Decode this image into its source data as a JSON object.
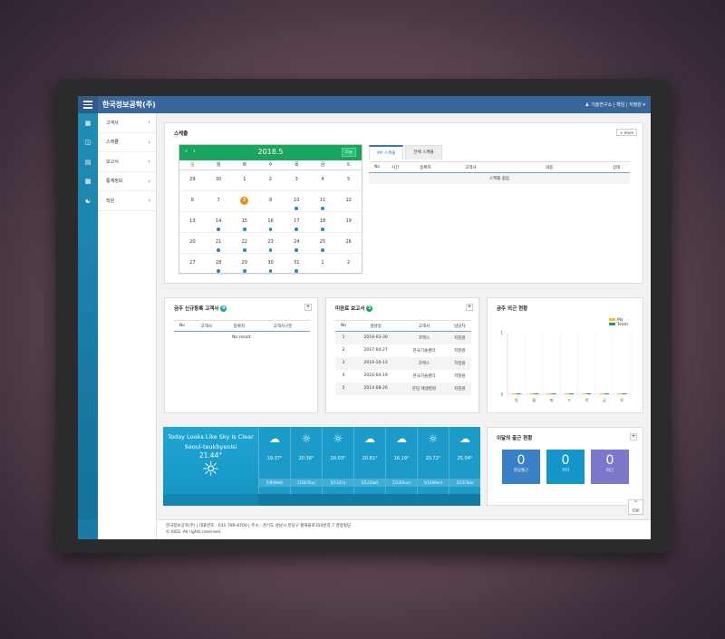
{
  "topbar": {
    "brand": "한국정보공학(주)",
    "user": "기술연구소 | 책임 | 지정원 ▾"
  },
  "sidebar": {
    "items": [
      {
        "label": "고객사",
        "icon": "briefcase-icon"
      },
      {
        "label": "스케쥴",
        "icon": "calendar-icon"
      },
      {
        "label": "보고서",
        "icon": "document-icon"
      },
      {
        "label": "통계정보",
        "icon": "bar-chart-icon"
      },
      {
        "label": "직원",
        "icon": "users-icon"
      }
    ]
  },
  "schedule": {
    "title": "스케쥴",
    "more": "+ more",
    "month": "2018.5",
    "today_btn": "오늘",
    "dow": [
      "일",
      "월",
      "화",
      "수",
      "목",
      "금",
      "토"
    ],
    "weeks": [
      [
        {
          "d": "29",
          "o": 1
        },
        {
          "d": "30",
          "o": 1
        },
        {
          "d": "1"
        },
        {
          "d": "2"
        },
        {
          "d": "3"
        },
        {
          "d": "4"
        },
        {
          "d": "5"
        }
      ],
      [
        {
          "d": "6"
        },
        {
          "d": "7"
        },
        {
          "d": "8",
          "t": 1
        },
        {
          "d": "9"
        },
        {
          "d": "10",
          "e": 1
        },
        {
          "d": "11",
          "e": 1
        },
        {
          "d": "12"
        }
      ],
      [
        {
          "d": "13"
        },
        {
          "d": "14",
          "e": 1
        },
        {
          "d": "15",
          "e": 1
        },
        {
          "d": "16",
          "e": 1
        },
        {
          "d": "17",
          "e": 1
        },
        {
          "d": "18",
          "e": 1
        },
        {
          "d": "19"
        }
      ],
      [
        {
          "d": "20"
        },
        {
          "d": "21",
          "e": 1
        },
        {
          "d": "22",
          "e": 1
        },
        {
          "d": "23",
          "e": 1
        },
        {
          "d": "24",
          "e": 1
        },
        {
          "d": "25",
          "e": 1
        },
        {
          "d": "26"
        }
      ],
      [
        {
          "d": "27"
        },
        {
          "d": "28",
          "e": 1
        },
        {
          "d": "29",
          "e": 1
        },
        {
          "d": "30",
          "e": 1
        },
        {
          "d": "31",
          "e": 1
        },
        {
          "d": "1",
          "o": 1
        },
        {
          "d": "2",
          "o": 1
        }
      ]
    ],
    "tabs": [
      "MY 스케쥴",
      "전체 스케쥴"
    ],
    "cols": [
      "No",
      "시간",
      "등록자",
      "고객사",
      "내용",
      "상태"
    ],
    "empty": "스케쥴 없음"
  },
  "customers": {
    "title": "금주 신규등록 고객사",
    "count": "0",
    "cols": [
      "No",
      "고객사",
      "등록자",
      "고객사구분"
    ],
    "empty": "No result."
  },
  "reports": {
    "title": "미완료 보고서",
    "count": "5",
    "cols": [
      "No",
      "생성일",
      "고객사",
      "담당자"
    ],
    "rows": [
      [
        "1",
        "2018-03-30",
        "코엑스",
        "지정원"
      ],
      [
        "2",
        "2017-04-27",
        "한국기술센터",
        "지정원"
      ],
      [
        "3",
        "2016-10-13",
        "코엑스",
        "지정원"
      ],
      [
        "4",
        "2016-04-19",
        "한국기술센터",
        "지정원"
      ],
      [
        "5",
        "2014-08-26",
        "분당 제생병원",
        "지정원"
      ]
    ]
  },
  "outside": {
    "title": "금주 외근 현황",
    "chart_data": {
      "type": "bar",
      "categories": [
        "일",
        "월",
        "화",
        "수",
        "목",
        "금",
        "토"
      ],
      "series": [
        {
          "name": "My",
          "values": [
            0,
            0,
            0,
            0,
            0,
            0,
            0
          ],
          "color": "#f0c419"
        },
        {
          "name": "Team",
          "values": [
            0,
            0,
            0,
            0,
            0,
            0,
            0
          ],
          "color": "#1aa55e"
        }
      ],
      "ylim": [
        0,
        1
      ],
      "yticks": [
        "1",
        "0"
      ],
      "legend": "top-right"
    }
  },
  "weather": {
    "headline": "Today Looks Like Sky Is Clear",
    "city": "Seoul-teukbyeolsi",
    "temp": "21.44°",
    "days": [
      {
        "icon": "cloud-icon",
        "temp": "19.37°",
        "date": "5/9(Wed)"
      },
      {
        "icon": "sun-icon",
        "temp": "20.36°",
        "date": "5/10(Thu)"
      },
      {
        "icon": "sun-icon",
        "temp": "20.03°",
        "date": "5/11(Fri)"
      },
      {
        "icon": "cloud-icon",
        "temp": "20.81°",
        "date": "5/12(Sat)"
      },
      {
        "icon": "cloud-icon",
        "temp": "16.19°",
        "date": "5/13(Sun)"
      },
      {
        "icon": "sun-icon",
        "temp": "20.72°",
        "date": "5/14(Mon)"
      },
      {
        "icon": "cloud-icon",
        "temp": "25.04°",
        "date": "5/15(Tue)"
      }
    ]
  },
  "attendance": {
    "title": "이달의 출근 현황",
    "boxes": [
      {
        "value": "0",
        "label": "정상출근",
        "color": "#3b7fc4"
      },
      {
        "value": "0",
        "label": "지각",
        "color": "#1596c9"
      },
      {
        "value": "0",
        "label": "외근",
        "color": "#7b78c9"
      }
    ]
  },
  "top_btn": "TOP",
  "footer": {
    "line1": "한국정보공학(주)  |  대표번호 : 031-789-8700  |  주소 : 경기도 성남시 분당구 황새울로354번길 7 경정빌딩",
    "line2": "© KIES. All rights reserved."
  }
}
